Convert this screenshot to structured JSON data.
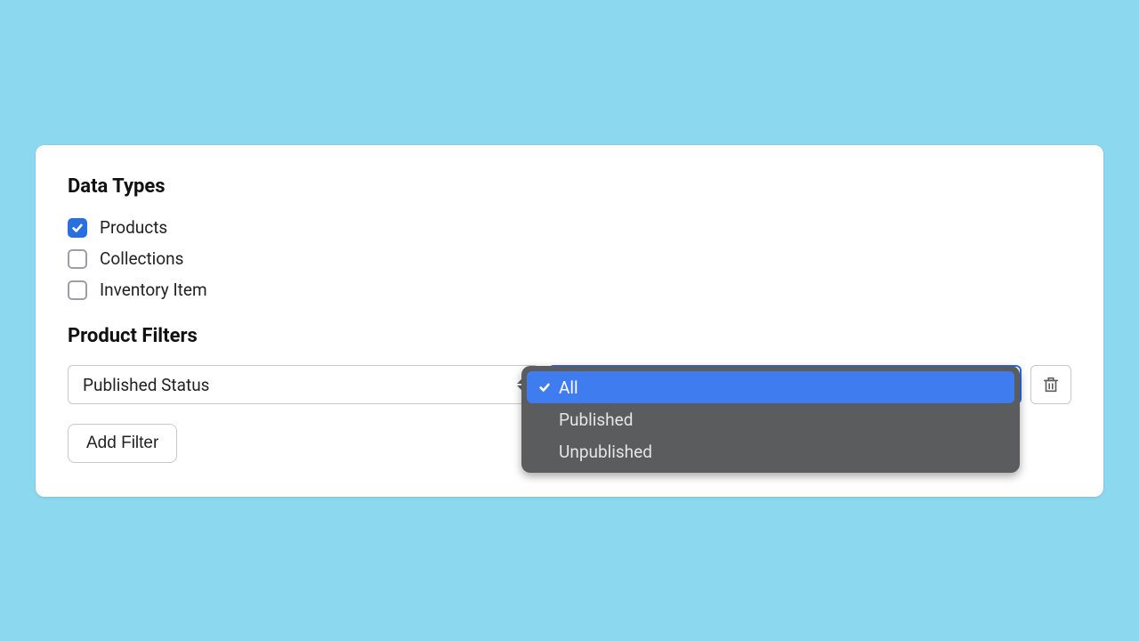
{
  "section_data_types_title": "Data Types",
  "data_types": [
    {
      "label": "Products",
      "checked": true
    },
    {
      "label": "Collections",
      "checked": false
    },
    {
      "label": "Inventory Item",
      "checked": false
    }
  ],
  "section_filters_title": "Product Filters",
  "filter_field_selected": "Published Status",
  "filter_value_selected": "All",
  "filter_value_options": [
    "All",
    "Published",
    "Unpublished"
  ],
  "add_filter_label": "Add Filter"
}
